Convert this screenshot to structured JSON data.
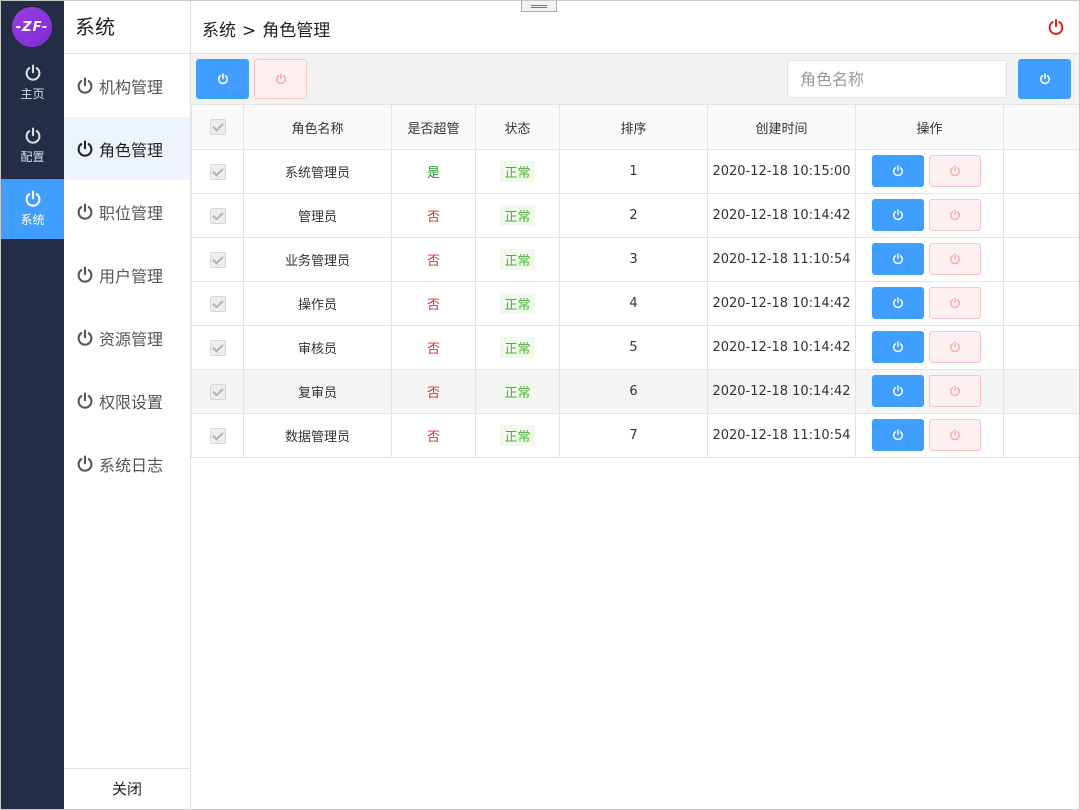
{
  "app": {
    "logo_text": "-ZF-",
    "colors": {
      "rail_bg": "#232d45",
      "accent": "#409eff",
      "danger": "#e03030",
      "success": "#1f9e2a"
    }
  },
  "rail": {
    "items": [
      {
        "label": "主页",
        "icon": "power-icon",
        "active": false
      },
      {
        "label": "配置",
        "icon": "power-icon",
        "active": false
      },
      {
        "label": "系统",
        "icon": "power-icon",
        "active": true
      }
    ]
  },
  "submenu": {
    "title": "系统",
    "items": [
      {
        "label": "机构管理",
        "icon": "power-icon"
      },
      {
        "label": "角色管理",
        "icon": "power-icon",
        "active": true
      },
      {
        "label": "职位管理",
        "icon": "power-icon"
      },
      {
        "label": "用户管理",
        "icon": "power-icon"
      },
      {
        "label": "资源管理",
        "icon": "power-icon"
      },
      {
        "label": "权限设置",
        "icon": "power-icon"
      },
      {
        "label": "系统日志",
        "icon": "power-icon"
      }
    ],
    "close_label": "关闭"
  },
  "header": {
    "breadcrumb": [
      "系统",
      ">",
      "角色管理"
    ]
  },
  "toolbar": {
    "search_placeholder": "角色名称",
    "search_value": ""
  },
  "table": {
    "columns": [
      "",
      "角色名称",
      "是否超管",
      "状态",
      "排序",
      "创建时间",
      "操作",
      ""
    ],
    "rows": [
      {
        "name": "系统管理员",
        "super": "是",
        "status": "正常",
        "order": "1",
        "created": "2020-12-18 10:15:00"
      },
      {
        "name": "管理员",
        "super": "否",
        "status": "正常",
        "order": "2",
        "created": "2020-12-18 10:14:42"
      },
      {
        "name": "业务管理员",
        "super": "否",
        "status": "正常",
        "order": "3",
        "created": "2020-12-18 11:10:54"
      },
      {
        "name": "操作员",
        "super": "否",
        "status": "正常",
        "order": "4",
        "created": "2020-12-18 10:14:42"
      },
      {
        "name": "审核员",
        "super": "否",
        "status": "正常",
        "order": "5",
        "created": "2020-12-18 10:14:42"
      },
      {
        "name": "复审员",
        "super": "否",
        "status": "正常",
        "order": "6",
        "created": "2020-12-18 10:14:42",
        "highlight": true
      },
      {
        "name": "数据管理员",
        "super": "否",
        "status": "正常",
        "order": "7",
        "created": "2020-12-18 11:10:54"
      }
    ]
  }
}
